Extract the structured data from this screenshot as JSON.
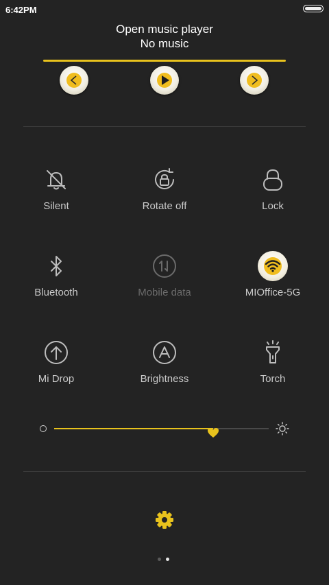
{
  "status": {
    "time": "6:42PM"
  },
  "music": {
    "title": "Open music player",
    "subtitle": "No music"
  },
  "controls": {
    "prev": "prev-icon",
    "play": "play-icon",
    "next": "next-icon"
  },
  "tiles": [
    {
      "label": "Silent",
      "icon": "bell-off-icon"
    },
    {
      "label": "Rotate off",
      "icon": "rotate-lock-icon"
    },
    {
      "label": "Lock",
      "icon": "lock-icon"
    },
    {
      "label": "Bluetooth",
      "icon": "bluetooth-icon"
    },
    {
      "label": "Mobile data",
      "icon": "mobile-data-icon",
      "enabled": false
    },
    {
      "label": "MIOffice-5G",
      "icon": "wifi-icon",
      "active": true
    },
    {
      "label": "Mi Drop",
      "icon": "mi-drop-icon"
    },
    {
      "label": "Brightness",
      "icon": "auto-brightness-icon"
    },
    {
      "label": "Torch",
      "icon": "torch-icon"
    }
  ],
  "brightness": {
    "level": 0.74
  },
  "pager": {
    "current": 2,
    "total": 2
  },
  "colors": {
    "accent": "#e8c21d",
    "background": "#232323",
    "text": "#c9c9c9"
  }
}
